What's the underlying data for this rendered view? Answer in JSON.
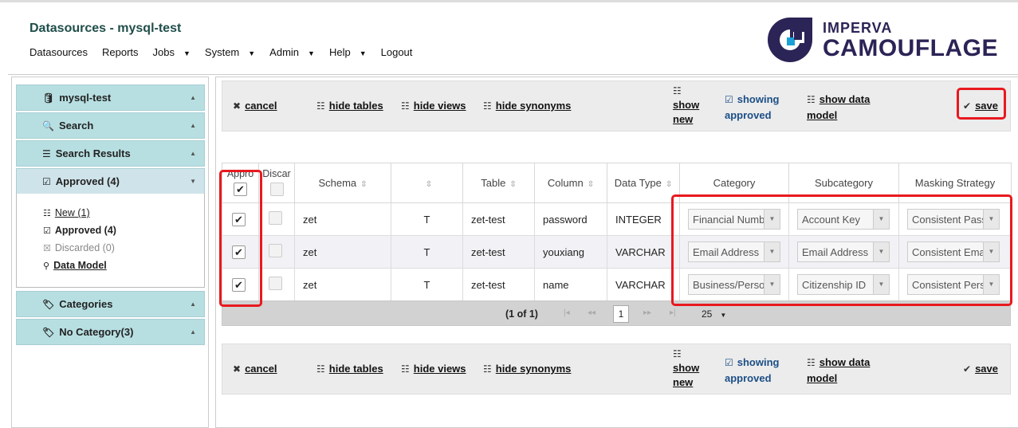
{
  "header": {
    "title": "Datasources - mysql-test",
    "nav": [
      {
        "label": "Datasources",
        "caret": false
      },
      {
        "label": "Reports",
        "caret": false
      },
      {
        "label": "Jobs",
        "caret": true
      },
      {
        "label": "System",
        "caret": true
      },
      {
        "label": "Admin",
        "caret": true
      },
      {
        "label": "Help",
        "caret": true
      },
      {
        "label": "Logout",
        "caret": false
      }
    ],
    "logo": {
      "line1": "IMPERVA",
      "line2": "CAMOUFLAGE",
      "color": "#2b2456"
    }
  },
  "sidebar": {
    "sections": [
      {
        "label": "mysql-test",
        "icon": "database-icon"
      },
      {
        "label": "Search",
        "icon": "search-icon"
      },
      {
        "label": "Search Results",
        "icon": "list-icon"
      },
      {
        "label": "Approved (4)",
        "icon": "approved-icon"
      },
      {
        "label": "Categories",
        "icon": "tag-icon"
      },
      {
        "label": "No Category(3)",
        "icon": "tag-icon"
      }
    ],
    "filters": [
      {
        "label": "New (1)"
      },
      {
        "label": "Approved (4)"
      },
      {
        "label": "Discarded (0)"
      },
      {
        "label": "Data Model"
      }
    ]
  },
  "toolbar": {
    "cancel": "cancel",
    "hide_tables": "hide tables",
    "hide_views": "hide views",
    "hide_synonyms": "hide synonyms",
    "show_new_1": "show",
    "show_new_2": "new",
    "showing_approved_1": "showing",
    "showing_approved_2": "approved",
    "show_data_model_1": "show data",
    "show_data_model_2": "model",
    "save": "save"
  },
  "grid": {
    "headers": {
      "approve": "Appro",
      "discard": "Discar",
      "schema": "Schema",
      "type": "",
      "table": "Table",
      "column": "Column",
      "data_type": "Data Type",
      "category": "Category",
      "subcategory": "Subcategory",
      "masking": "Masking Strategy"
    },
    "rows": [
      {
        "approved": true,
        "schema": "zet",
        "type": "T",
        "table": "zet-test",
        "column": "password",
        "data_type": "INTEGER",
        "category": "Financial Numb",
        "subcategory": "Account Key",
        "masking": "Consistent Pass"
      },
      {
        "approved": true,
        "schema": "zet",
        "type": "T",
        "table": "zet-test",
        "column": "youxiang",
        "data_type": "VARCHAR",
        "category": "Email Address",
        "subcategory": "Email Address",
        "masking": "Consistent Ema"
      },
      {
        "approved": true,
        "schema": "zet",
        "type": "T",
        "table": "zet-test",
        "column": "name",
        "data_type": "VARCHAR",
        "category": "Business/Perso",
        "subcategory": "Citizenship ID",
        "masking": "Consistent Pers"
      }
    ]
  },
  "pager": {
    "summary": "(1 of 1)",
    "current_page": "1",
    "page_size": "25"
  },
  "colors": {
    "accent": "#1b4e86",
    "sidebar": "#b7dfe2",
    "highlight": "#e8191f"
  }
}
